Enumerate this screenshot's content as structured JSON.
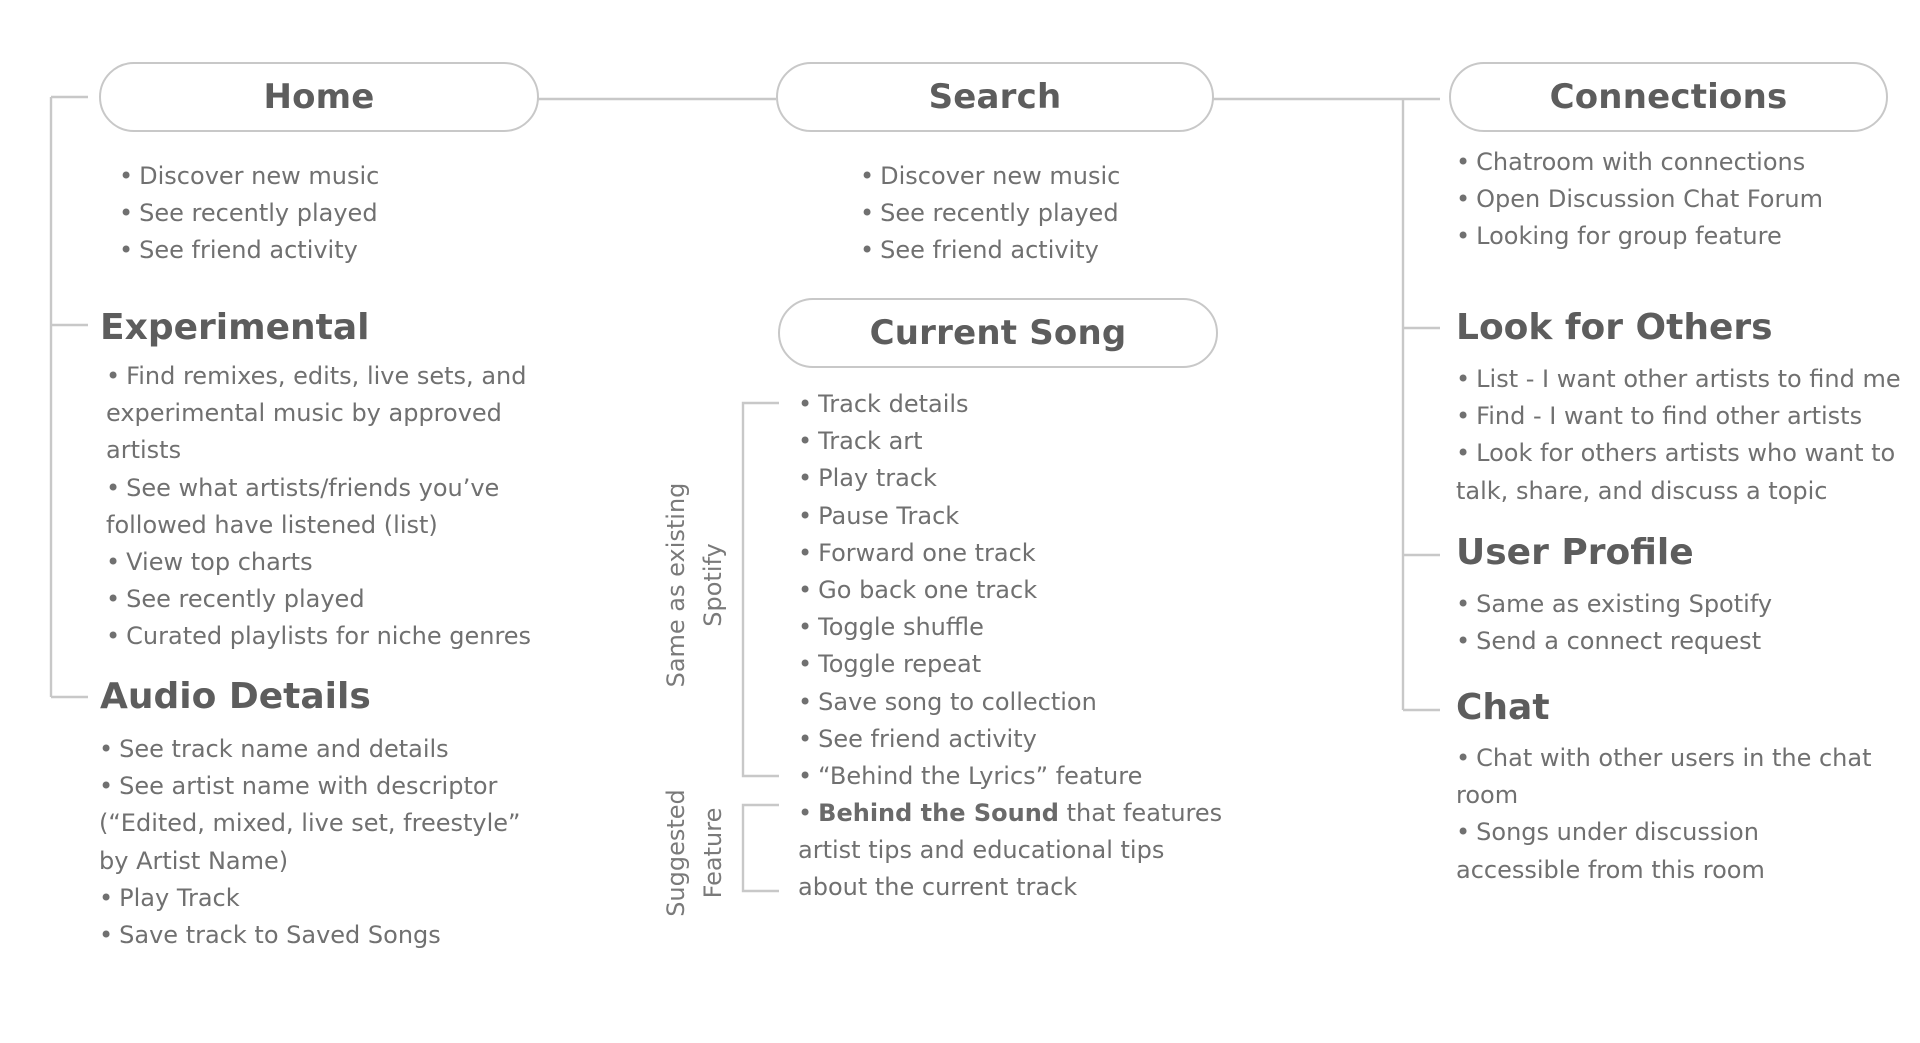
{
  "columns": {
    "left": {
      "pill": {
        "title": "Home",
        "items": [
          "Discover new music",
          "See recently played",
          "See friend activity"
        ]
      },
      "sections": [
        {
          "title": "Experimental",
          "items": [
            "Find remixes, edits, live sets, and experimental music by approved artists",
            "See what artists/friends you’ve followed have listened (list)",
            "View top charts",
            "See recently played",
            "Curated playlists for niche genres"
          ]
        },
        {
          "title": "Audio Details",
          "items": [
            "See track name and details",
            "See artist name with descriptor (“Edited, mixed, live set, freestyle” by Artist Name)",
            "Play Track",
            "Save track to Saved Songs"
          ]
        }
      ]
    },
    "middle": {
      "pill": {
        "title": "Search",
        "items": [
          "Discover new music",
          "See recently played",
          "See friend activity"
        ]
      },
      "current_song": {
        "title": "Current Song",
        "existing_label": [
          "Same as existing",
          "Spotify"
        ],
        "existing_items": [
          "Track details",
          "Track art",
          "Play track",
          "Pause Track",
          "Forward one track",
          "Go back one track",
          "Toggle shuffle",
          "Toggle repeat",
          "Save song to collection",
          "See friend activity",
          "“Behind the Lyrics” feature"
        ],
        "suggested_label": [
          "Suggested",
          "Feature"
        ],
        "suggested_bold": "Behind the Sound",
        "suggested_rest_line1": " that features",
        "suggested_line2": "artist tips and educational tips",
        "suggested_line3": "about the current track"
      }
    },
    "right": {
      "pill": {
        "title": "Connections",
        "items": [
          "Chatroom with connections",
          "Open Discussion Chat Forum",
          "Looking for group feature"
        ]
      },
      "sections": [
        {
          "title": "Look for Others",
          "items": [
            "List - I want other artists to find me",
            "Find - I want to find other artists",
            "Look for others artists who want to talk, share, and discuss a topic"
          ]
        },
        {
          "title": "User Profile",
          "items": [
            "Same as existing Spotify",
            "Send a connect request"
          ]
        },
        {
          "title": "Chat",
          "items": [
            "Chat with other users in the chat room",
            "Songs under discussion accessible from this room"
          ]
        }
      ]
    }
  },
  "bullet": "•",
  "colors": {
    "line": "#c8c8c8",
    "heading": "#5d5d5d",
    "text": "#707070"
  }
}
